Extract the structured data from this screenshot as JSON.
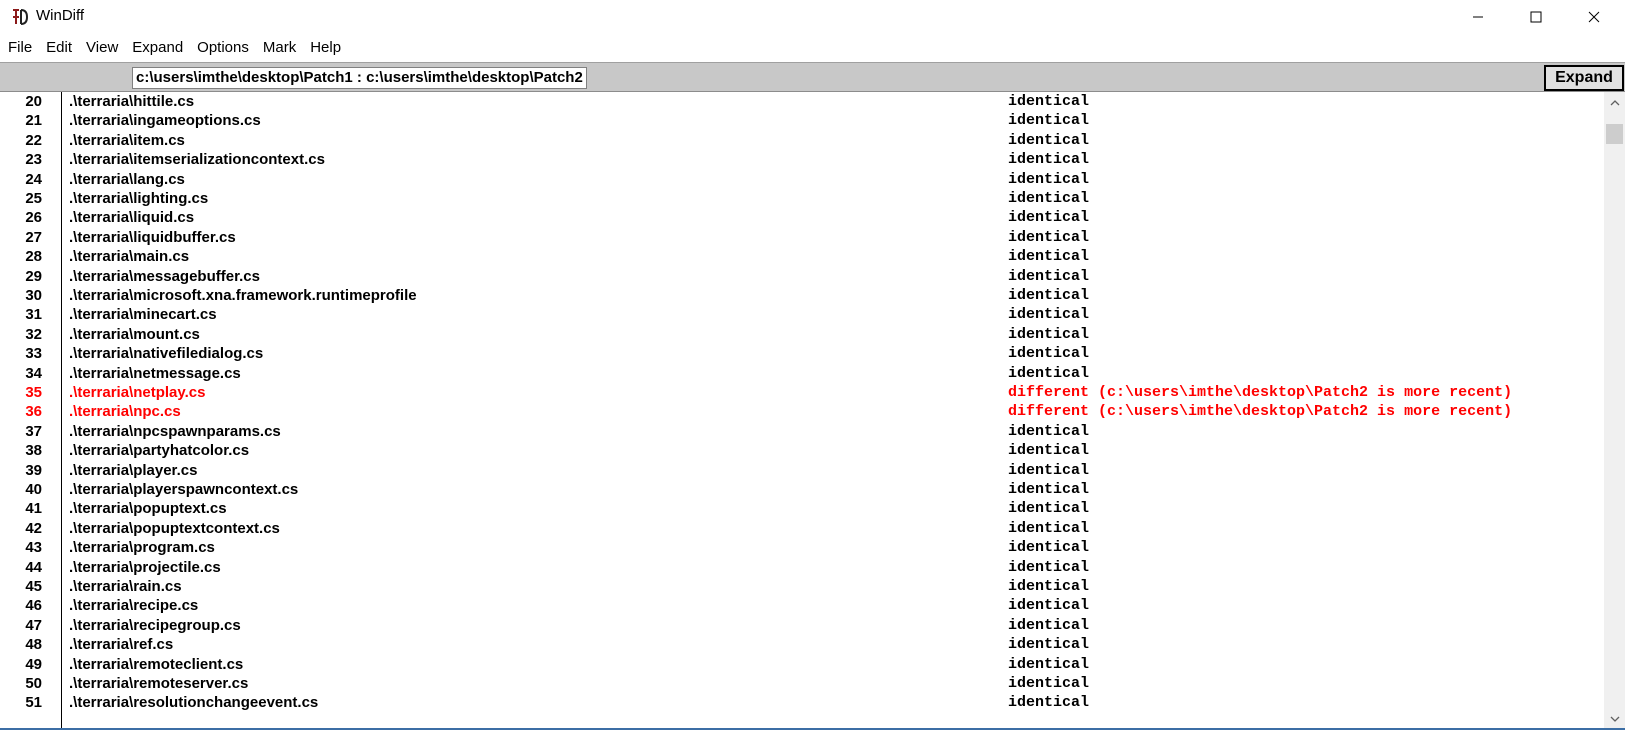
{
  "window": {
    "title": "WinDiff"
  },
  "menu": [
    "File",
    "Edit",
    "View",
    "Expand",
    "Options",
    "Mark",
    "Help"
  ],
  "pathbar": {
    "path": "c:\\users\\imthe\\desktop\\Patch1 : c:\\users\\imthe\\desktop\\Patch2",
    "expand_label": "Expand"
  },
  "colors": {
    "different": "#ff0000",
    "identical": "#000000"
  },
  "rows": [
    {
      "num": "20",
      "file": ".\\terraria\\hittile.cs",
      "status": "identical",
      "diff": false
    },
    {
      "num": "21",
      "file": ".\\terraria\\ingameoptions.cs",
      "status": "identical",
      "diff": false
    },
    {
      "num": "22",
      "file": ".\\terraria\\item.cs",
      "status": "identical",
      "diff": false
    },
    {
      "num": "23",
      "file": ".\\terraria\\itemserializationcontext.cs",
      "status": "identical",
      "diff": false
    },
    {
      "num": "24",
      "file": ".\\terraria\\lang.cs",
      "status": "identical",
      "diff": false
    },
    {
      "num": "25",
      "file": ".\\terraria\\lighting.cs",
      "status": "identical",
      "diff": false
    },
    {
      "num": "26",
      "file": ".\\terraria\\liquid.cs",
      "status": "identical",
      "diff": false
    },
    {
      "num": "27",
      "file": ".\\terraria\\liquidbuffer.cs",
      "status": "identical",
      "diff": false
    },
    {
      "num": "28",
      "file": ".\\terraria\\main.cs",
      "status": "identical",
      "diff": false
    },
    {
      "num": "29",
      "file": ".\\terraria\\messagebuffer.cs",
      "status": "identical",
      "diff": false
    },
    {
      "num": "30",
      "file": ".\\terraria\\microsoft.xna.framework.runtimeprofile",
      "status": "identical",
      "diff": false
    },
    {
      "num": "31",
      "file": ".\\terraria\\minecart.cs",
      "status": "identical",
      "diff": false
    },
    {
      "num": "32",
      "file": ".\\terraria\\mount.cs",
      "status": "identical",
      "diff": false
    },
    {
      "num": "33",
      "file": ".\\terraria\\nativefiledialog.cs",
      "status": "identical",
      "diff": false
    },
    {
      "num": "34",
      "file": ".\\terraria\\netmessage.cs",
      "status": "identical",
      "diff": false
    },
    {
      "num": "35",
      "file": ".\\terraria\\netplay.cs",
      "status": "different (c:\\users\\imthe\\desktop\\Patch2 is more recent)",
      "diff": true
    },
    {
      "num": "36",
      "file": ".\\terraria\\npc.cs",
      "status": "different (c:\\users\\imthe\\desktop\\Patch2 is more recent)",
      "diff": true
    },
    {
      "num": "37",
      "file": ".\\terraria\\npcspawnparams.cs",
      "status": "identical",
      "diff": false
    },
    {
      "num": "38",
      "file": ".\\terraria\\partyhatcolor.cs",
      "status": "identical",
      "diff": false
    },
    {
      "num": "39",
      "file": ".\\terraria\\player.cs",
      "status": "identical",
      "diff": false
    },
    {
      "num": "40",
      "file": ".\\terraria\\playerspawncontext.cs",
      "status": "identical",
      "diff": false
    },
    {
      "num": "41",
      "file": ".\\terraria\\popuptext.cs",
      "status": "identical",
      "diff": false
    },
    {
      "num": "42",
      "file": ".\\terraria\\popuptextcontext.cs",
      "status": "identical",
      "diff": false
    },
    {
      "num": "43",
      "file": ".\\terraria\\program.cs",
      "status": "identical",
      "diff": false
    },
    {
      "num": "44",
      "file": ".\\terraria\\projectile.cs",
      "status": "identical",
      "diff": false
    },
    {
      "num": "45",
      "file": ".\\terraria\\rain.cs",
      "status": "identical",
      "diff": false
    },
    {
      "num": "46",
      "file": ".\\terraria\\recipe.cs",
      "status": "identical",
      "diff": false
    },
    {
      "num": "47",
      "file": ".\\terraria\\recipegroup.cs",
      "status": "identical",
      "diff": false
    },
    {
      "num": "48",
      "file": ".\\terraria\\ref.cs",
      "status": "identical",
      "diff": false
    },
    {
      "num": "49",
      "file": ".\\terraria\\remoteclient.cs",
      "status": "identical",
      "diff": false
    },
    {
      "num": "50",
      "file": ".\\terraria\\remoteserver.cs",
      "status": "identical",
      "diff": false
    },
    {
      "num": "51",
      "file": ".\\terraria\\resolutionchangeevent.cs",
      "status": "identical",
      "diff": false
    }
  ]
}
